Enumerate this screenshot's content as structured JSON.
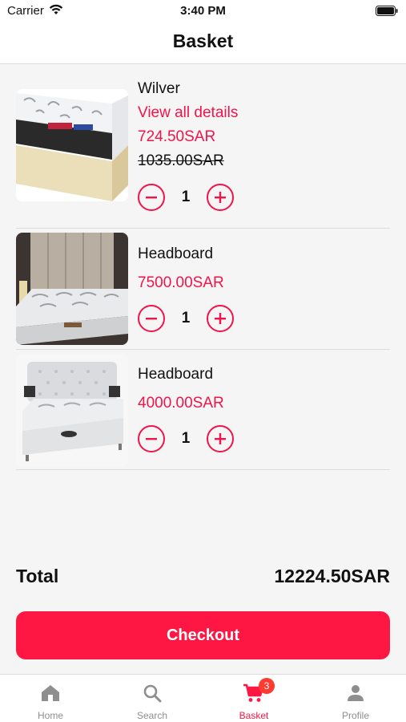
{
  "status_bar": {
    "carrier": "Carrier",
    "time": "3:40 PM"
  },
  "header": {
    "title": "Basket"
  },
  "items": [
    {
      "name": "Wilver",
      "link": "View all details",
      "price": "724.50SAR",
      "old_price": "1035.00SAR",
      "quantity": "1"
    },
    {
      "name": "Headboard",
      "price": "7500.00SAR",
      "quantity": "1"
    },
    {
      "name": "Headboard",
      "price": "4000.00SAR",
      "quantity": "1"
    }
  ],
  "total": {
    "label": "Total",
    "value": "12224.50SAR"
  },
  "checkout_label": "Checkout",
  "tabs": [
    {
      "label": "Home",
      "icon": "home-icon"
    },
    {
      "label": "Search",
      "icon": "search-icon"
    },
    {
      "label": "Basket",
      "icon": "cart-icon",
      "badge": "3",
      "active": true
    },
    {
      "label": "Profile",
      "icon": "person-icon"
    }
  ],
  "colors": {
    "accent": "#ff1744",
    "price": "#f0144b",
    "inactive": "#8e8e8e"
  }
}
